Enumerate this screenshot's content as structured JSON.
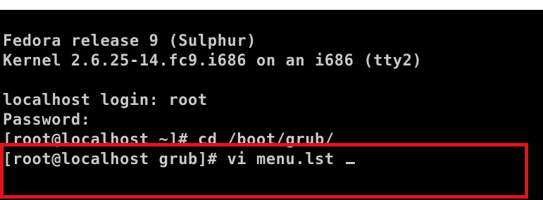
{
  "terminal": {
    "lines": {
      "release": "Fedora release 9 (Sulphur)",
      "kernel": "Kernel 2.6.25-14.fc9.i686 on an i686 (tty2)",
      "login": "localhost login: root",
      "password": "Password:",
      "cmd1": "[root@localhost ~]# cd /boot/grub/",
      "cmd2": "[root@localhost grub]# vi menu.lst "
    },
    "text_color": "#c9c9c9",
    "background_color": "#000000",
    "cursor_glyph": "_"
  },
  "annotation": {
    "highlight_color": "#e0141b"
  }
}
